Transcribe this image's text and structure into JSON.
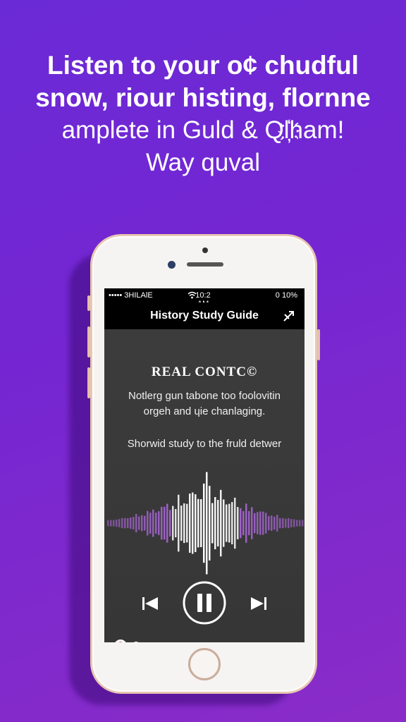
{
  "headline": {
    "line1": "Listen to your o¢ chudful",
    "line2": "snow, riour histing, flornne",
    "line3": "amplete in Guld & Ql҉ham!",
    "line4": "Way quval"
  },
  "status_bar": {
    "carrier": "••••• 3HILAlE",
    "time": "10:2 AM",
    "battery": "0 10%"
  },
  "nav": {
    "title": "History Study Guide"
  },
  "content": {
    "heading": "REAL CONTC©",
    "body_line1": "Notlerg gun tabone too foolovitin",
    "body_line2": "orgeh and ɥie chanlaging.",
    "subtext": "Shorwid study to the fruld detwer"
  },
  "player": {
    "progress": 0.02
  },
  "colors": {
    "background_start": "#6a2ad6",
    "background_end": "#8a2cc8",
    "waveform": "#b56be8",
    "screen": "#3a3a3a"
  },
  "icons": [
    "wifi-icon",
    "share-icon",
    "previous-icon",
    "pause-icon",
    "next-icon",
    "cast-icon",
    "download-icon"
  ]
}
